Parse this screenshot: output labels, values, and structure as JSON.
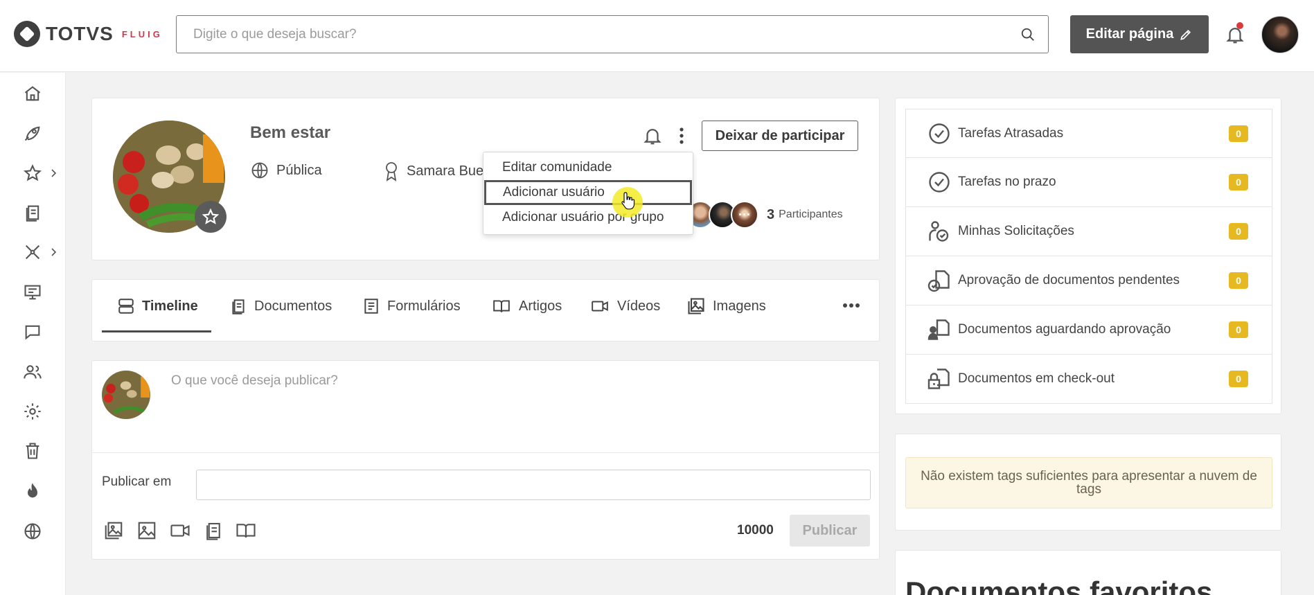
{
  "header": {
    "logo_text": "TOTVS",
    "logo_sub": "FLUIG",
    "search_placeholder": "Digite o que deseja buscar?",
    "edit_button": "Editar página"
  },
  "sidebar": {
    "icons": [
      "home-icon",
      "rocket-icon",
      "star-icon",
      "documents-icon",
      "workflow-icon",
      "monitor-icon",
      "chat-icon",
      "users-icon",
      "gear-icon",
      "trash-icon",
      "tag-icon",
      "globe-icon"
    ]
  },
  "community": {
    "title": "Bem estar",
    "visibility": "Pública",
    "owner": "Samara Buet",
    "leave_button": "Deixar de participar",
    "participant_count": "3",
    "participant_label": "Participantes"
  },
  "menu": {
    "items": [
      "Editar comunidade",
      "Adicionar usuário",
      "Adicionar usuário por grupo"
    ]
  },
  "tabs": [
    "Timeline",
    "Documentos",
    "Formulários",
    "Artigos",
    "Vídeos",
    "Imagens"
  ],
  "post": {
    "placeholder": "O que você deseja publicar?",
    "publish_in_label": "Publicar em",
    "char_count": "10000",
    "publish_button": "Publicar"
  },
  "tasks": [
    {
      "label": "Tarefas Atrasadas",
      "count": "0"
    },
    {
      "label": "Tarefas no prazo",
      "count": "0"
    },
    {
      "label": "Minhas Solicitações",
      "count": "0"
    },
    {
      "label": "Aprovação de documentos pendentes",
      "count": "0"
    },
    {
      "label": "Documentos aguardando aprovação",
      "count": "0"
    },
    {
      "label": "Documentos em check-out",
      "count": "0"
    }
  ],
  "tags_note": "Não existem tags suficientes para apresentar a nuvem de tags",
  "favorites_title": "Documentos favoritos",
  "colors": {
    "accent_dark": "#545454",
    "badge": "#e6b822",
    "notification_dot": "#d93a3a",
    "logo_red": "#d0384a"
  }
}
